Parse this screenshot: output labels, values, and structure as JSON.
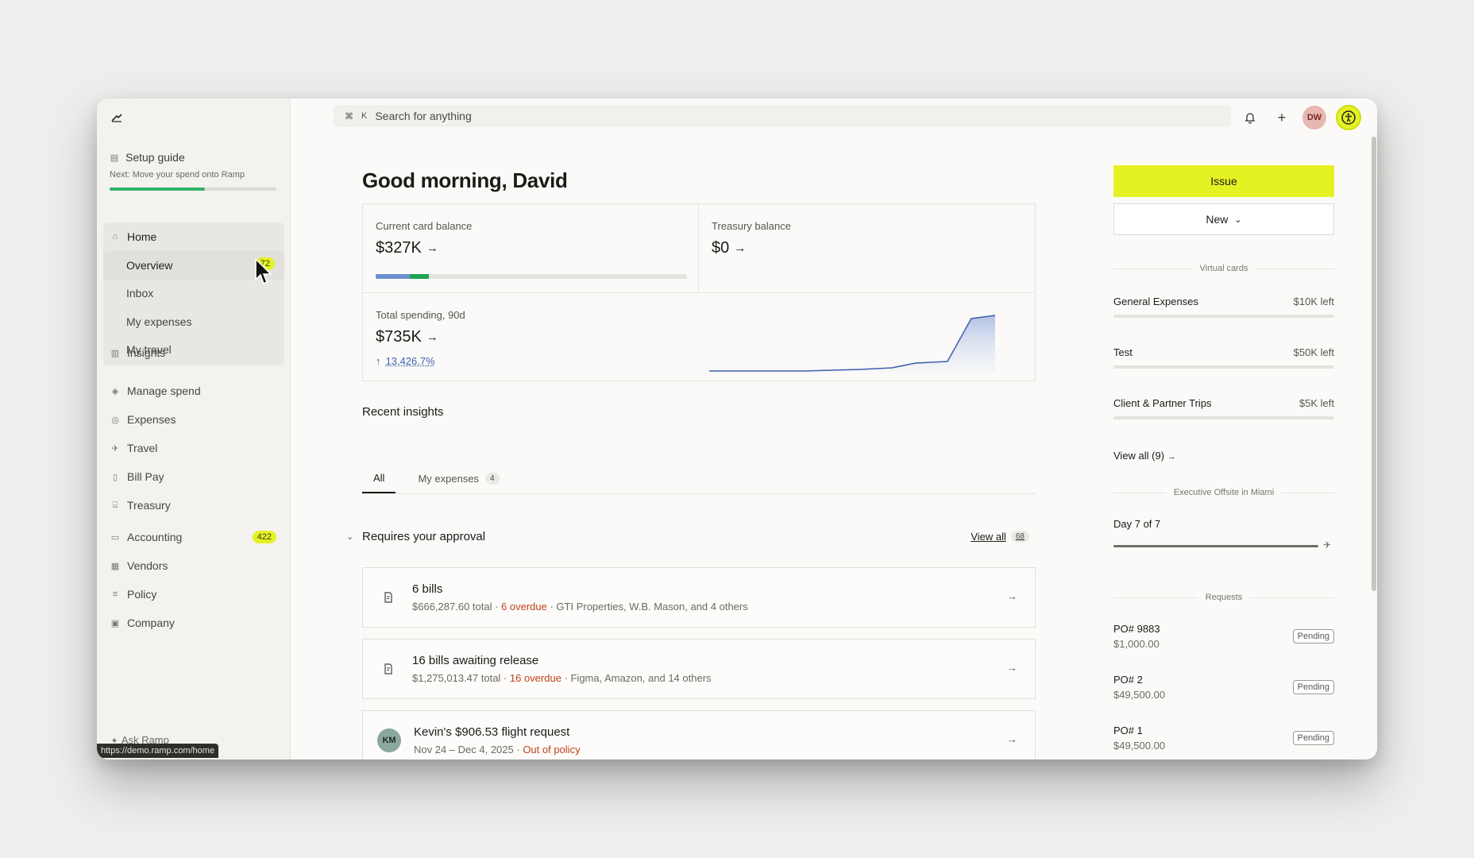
{
  "sidebar": {
    "setup_title": "Setup guide",
    "setup_sub": "Next: Move your spend onto Ramp",
    "setup_progress": 0.57,
    "home": {
      "label": "Home",
      "subitems": [
        {
          "label": "Overview",
          "badge": "72"
        },
        {
          "label": "Inbox"
        },
        {
          "label": "My expenses"
        },
        {
          "label": "My travel"
        }
      ]
    },
    "insights": "Insights",
    "spend_group": [
      "Manage spend",
      "Expenses",
      "Travel",
      "Bill Pay",
      "Treasury"
    ],
    "accounting": {
      "label": "Accounting",
      "badge": "422"
    },
    "company_group": [
      "Vendors",
      "Policy",
      "Company"
    ],
    "ask_ramp": "Ask Ramp",
    "url_tooltip": "https://demo.ramp.com/home"
  },
  "topbar": {
    "search_shortcut_1": "⌘",
    "search_shortcut_2": "K",
    "search_placeholder": "Search for anything",
    "avatar_initials": "DW"
  },
  "main": {
    "greeting": "Good morning, David",
    "cards": {
      "card_balance_label": "Current card balance",
      "card_balance_value": "$327K",
      "card_balance_segments": [
        0.11,
        0.06
      ],
      "treasury_label": "Treasury balance",
      "treasury_value": "$0",
      "spending_label": "Total spending, 90d",
      "spending_value": "$735K",
      "spending_change": "13,426.7%"
    },
    "recent_insights": "Recent insights",
    "tabs": [
      {
        "label": "All"
      },
      {
        "label": "My expenses",
        "count": "4"
      }
    ],
    "approval": {
      "title": "Requires your approval",
      "view_all": "View all",
      "count": "68"
    },
    "rows": [
      {
        "title": "6 bills",
        "total": "$666,287.60 total · ",
        "overdue": "6 overdue",
        "rest": " · GTI Properties, W.B. Mason, and 4 others"
      },
      {
        "title": "16 bills awaiting release",
        "total": "$1,275,013.47 total · ",
        "overdue": "16 overdue",
        "rest": " · Figma, Amazon, and 14 others"
      },
      {
        "title": "Kevin's $906.53 flight request",
        "initials": "KM",
        "total": "Nov 24 – Dec 4, 2025 · ",
        "overdue": "Out of policy",
        "rest": ""
      }
    ]
  },
  "right": {
    "issue": "Issue",
    "new": "New",
    "virtual_cards_label": "Virtual cards",
    "virtual_cards": [
      {
        "name": "General Expenses",
        "left": "$10K left"
      },
      {
        "name": "Test",
        "left": "$50K left"
      },
      {
        "name": "Client & Partner Trips",
        "left": "$5K left"
      }
    ],
    "view_all_cards": "View all (9)",
    "trip_label": "Executive Offsite in Miami",
    "trip_day": "Day 7 of 7",
    "requests_label": "Requests",
    "requests": [
      {
        "title": "PO# 9883",
        "amount": "$1,000.00",
        "status": "Pending"
      },
      {
        "title": "PO# 2",
        "amount": "$49,500.00",
        "status": "Pending"
      },
      {
        "title": "PO# 1",
        "amount": "$49,500.00",
        "status": "Pending"
      }
    ]
  },
  "colors": {
    "accent_yellow": "#e4f223",
    "progress_green": "#2fb26a",
    "overdue_red": "#c0421c",
    "chart_blue": "#3d5fae"
  }
}
